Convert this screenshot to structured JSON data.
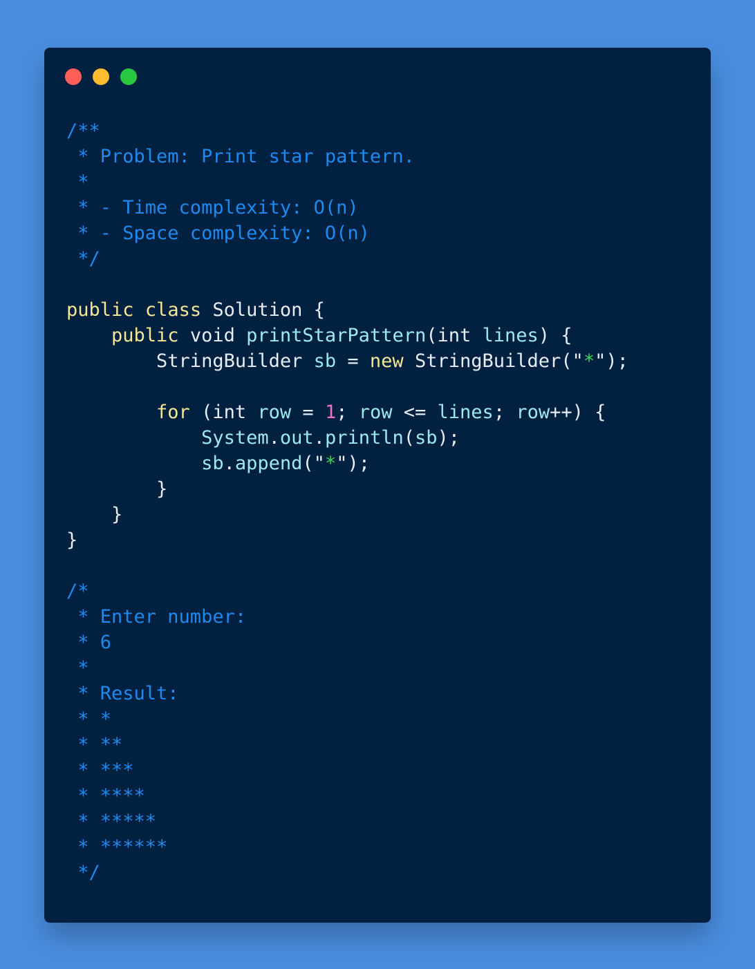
{
  "window": {
    "dots": [
      {
        "name": "close",
        "color": "#ff5f57"
      },
      {
        "name": "minimize",
        "color": "#febc2e"
      },
      {
        "name": "maximize",
        "color": "#28c840"
      }
    ]
  },
  "colors": {
    "background": "#4a8ee0",
    "window": "#022140",
    "comment": "#1e8af0",
    "keyword": "#f4e796",
    "identifier": "#e6edf5",
    "method": "#9fe8f2",
    "string": "#3fd35a",
    "number": "#f06ec6"
  },
  "code": {
    "lines": [
      {
        "segments": [
          {
            "t": "/**",
            "c": "comment"
          }
        ]
      },
      {
        "segments": [
          {
            "t": " * Problem: Print star pattern.",
            "c": "comment"
          }
        ]
      },
      {
        "segments": [
          {
            "t": " *",
            "c": "comment"
          }
        ]
      },
      {
        "segments": [
          {
            "t": " * - Time complexity: O(n)",
            "c": "comment"
          }
        ]
      },
      {
        "segments": [
          {
            "t": " * - Space complexity: O(n)",
            "c": "comment"
          }
        ]
      },
      {
        "segments": [
          {
            "t": " */",
            "c": "comment"
          }
        ]
      },
      {
        "segments": [
          {
            "t": "",
            "c": "plain"
          }
        ]
      },
      {
        "segments": [
          {
            "t": "public",
            "c": "kw"
          },
          {
            "t": " ",
            "c": "plain"
          },
          {
            "t": "class",
            "c": "kw"
          },
          {
            "t": " Solution {",
            "c": "plain"
          }
        ]
      },
      {
        "segments": [
          {
            "t": "    ",
            "c": "plain"
          },
          {
            "t": "public",
            "c": "kw"
          },
          {
            "t": " void ",
            "c": "plain"
          },
          {
            "t": "printStarPattern",
            "c": "fn"
          },
          {
            "t": "(int ",
            "c": "plain"
          },
          {
            "t": "lines",
            "c": "fn"
          },
          {
            "t": ") {",
            "c": "plain"
          }
        ]
      },
      {
        "segments": [
          {
            "t": "        StringBuilder ",
            "c": "plain"
          },
          {
            "t": "sb",
            "c": "fn"
          },
          {
            "t": " = ",
            "c": "plain"
          },
          {
            "t": "new",
            "c": "kw"
          },
          {
            "t": " StringBuilder(",
            "c": "plain"
          },
          {
            "t": "\"",
            "c": "str"
          },
          {
            "t": "*",
            "c": "strin"
          },
          {
            "t": "\"",
            "c": "str"
          },
          {
            "t": ");",
            "c": "plain"
          }
        ]
      },
      {
        "segments": [
          {
            "t": "",
            "c": "plain"
          }
        ]
      },
      {
        "segments": [
          {
            "t": "        ",
            "c": "plain"
          },
          {
            "t": "for",
            "c": "kw"
          },
          {
            "t": " (int ",
            "c": "plain"
          },
          {
            "t": "row",
            "c": "fn"
          },
          {
            "t": " = ",
            "c": "plain"
          },
          {
            "t": "1",
            "c": "num"
          },
          {
            "t": "; ",
            "c": "plain"
          },
          {
            "t": "row",
            "c": "fn"
          },
          {
            "t": " <= ",
            "c": "plain"
          },
          {
            "t": "lines",
            "c": "fn"
          },
          {
            "t": "; ",
            "c": "plain"
          },
          {
            "t": "row",
            "c": "fn"
          },
          {
            "t": "++) {",
            "c": "plain"
          }
        ]
      },
      {
        "segments": [
          {
            "t": "            ",
            "c": "plain"
          },
          {
            "t": "System",
            "c": "fn"
          },
          {
            "t": ".",
            "c": "plain"
          },
          {
            "t": "out",
            "c": "fn"
          },
          {
            "t": ".",
            "c": "plain"
          },
          {
            "t": "println",
            "c": "fn"
          },
          {
            "t": "(",
            "c": "plain"
          },
          {
            "t": "sb",
            "c": "fn"
          },
          {
            "t": ");",
            "c": "plain"
          }
        ]
      },
      {
        "segments": [
          {
            "t": "            ",
            "c": "plain"
          },
          {
            "t": "sb",
            "c": "fn"
          },
          {
            "t": ".",
            "c": "plain"
          },
          {
            "t": "append",
            "c": "fn"
          },
          {
            "t": "(",
            "c": "plain"
          },
          {
            "t": "\"",
            "c": "str"
          },
          {
            "t": "*",
            "c": "strin"
          },
          {
            "t": "\"",
            "c": "str"
          },
          {
            "t": ");",
            "c": "plain"
          }
        ]
      },
      {
        "segments": [
          {
            "t": "        }",
            "c": "plain"
          }
        ]
      },
      {
        "segments": [
          {
            "t": "    }",
            "c": "plain"
          }
        ]
      },
      {
        "segments": [
          {
            "t": "}",
            "c": "plain"
          }
        ]
      },
      {
        "segments": [
          {
            "t": "",
            "c": "plain"
          }
        ]
      },
      {
        "segments": [
          {
            "t": "/*",
            "c": "comment"
          }
        ]
      },
      {
        "segments": [
          {
            "t": " * Enter number:",
            "c": "comment"
          }
        ]
      },
      {
        "segments": [
          {
            "t": " * 6",
            "c": "comment"
          }
        ]
      },
      {
        "segments": [
          {
            "t": " *",
            "c": "comment"
          }
        ]
      },
      {
        "segments": [
          {
            "t": " * Result:",
            "c": "comment"
          }
        ]
      },
      {
        "segments": [
          {
            "t": " * *",
            "c": "comment"
          }
        ]
      },
      {
        "segments": [
          {
            "t": " * **",
            "c": "comment"
          }
        ]
      },
      {
        "segments": [
          {
            "t": " * ***",
            "c": "comment"
          }
        ]
      },
      {
        "segments": [
          {
            "t": " * ****",
            "c": "comment"
          }
        ]
      },
      {
        "segments": [
          {
            "t": " * *****",
            "c": "comment"
          }
        ]
      },
      {
        "segments": [
          {
            "t": " * ******",
            "c": "comment"
          }
        ]
      },
      {
        "segments": [
          {
            "t": " */",
            "c": "comment"
          }
        ]
      }
    ]
  }
}
